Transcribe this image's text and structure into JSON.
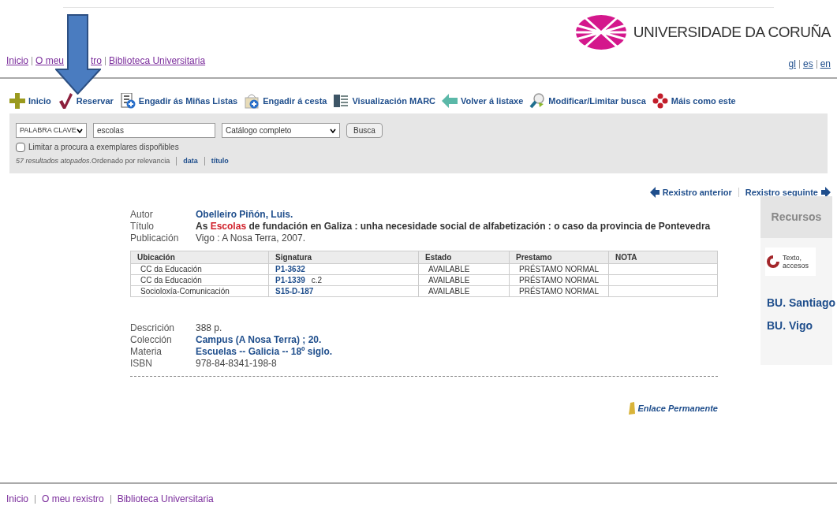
{
  "header": {
    "logo_text": "UNIVERSIDADE DA CORUÑA",
    "links": [
      {
        "parts": [
          "Inicio"
        ]
      },
      {
        "parts": [
          "O meu",
          "tro"
        ]
      },
      {
        "parts": [
          "Biblioteca Universitaria"
        ]
      }
    ],
    "languages": [
      "gl",
      "es",
      "en"
    ]
  },
  "toolbar": [
    {
      "kind": "plus",
      "label": "Inicio"
    },
    {
      "kind": "check",
      "label": "Reservar"
    },
    {
      "kind": "list",
      "label": "Engadir ás Miñas Listas"
    },
    {
      "kind": "bag",
      "label": "Engadir á cesta"
    },
    {
      "kind": "marc",
      "label": "Visualización MARC"
    },
    {
      "kind": "back",
      "label": "Volver á listaxe"
    },
    {
      "kind": "magnifier",
      "label": "Modificar/Limitar busca"
    },
    {
      "kind": "dots",
      "label": "Máis como este"
    }
  ],
  "search": {
    "index": "PALABRA CLAVE",
    "query": "escolas",
    "catalog": "Catálogo completo",
    "button": "Busca",
    "limit_label": "Limitar a procura a exemplares dispoñibles",
    "limit_checked": false,
    "results": "57 resultados atopados.",
    "sort_text": "Ordenado por relevancia",
    "sort_links": [
      "data",
      "título"
    ]
  },
  "record_nav": {
    "previous": "Rexistro anterior",
    "next": "Rexistro seguinte"
  },
  "record": {
    "fields": [
      {
        "label": "Autor",
        "kind": "link",
        "value": "Obelleiro Piñón, Luis."
      },
      {
        "label": "Título",
        "kind": "title",
        "before": "As ",
        "highlight": "Escolas",
        "after": " de fundación en Galiza : unha necesidade social de alfabetización : o caso da provincia de Pontevedra"
      },
      {
        "label": "Publicación",
        "kind": "plain",
        "value": "Vigo : A Nosa Terra, 2007."
      }
    ],
    "holdings": {
      "columns": [
        "Ubicación",
        "Signatura",
        "Estado",
        "Prestamo",
        "NOTA"
      ],
      "rows": [
        {
          "location": "CC da Educación",
          "signature": "P1-3632",
          "status": "AVAILABLE",
          "loan": "PRÉSTAMO NORMAL"
        },
        {
          "location": "CC da Educación",
          "signature": "P1-1339",
          "copy": "c.2",
          "status": "AVAILABLE",
          "loan": "PRÉSTAMO NORMAL"
        },
        {
          "location": "Socioloxía-Comunicación",
          "signature": "S15-D-187",
          "status": "AVAILABLE",
          "loan": "PRÉSTAMO NORMAL"
        }
      ]
    },
    "details": [
      {
        "label": "Descrición",
        "kind": "plain",
        "value": "388 p."
      },
      {
        "label": "Colección",
        "kind": "link",
        "value": "Campus (A Nosa Terra) ;  20."
      },
      {
        "label": "Materia",
        "kind": "link",
        "value": "Escuelas -- Galicia -- 18º siglo."
      },
      {
        "label": "ISBN",
        "kind": "plain",
        "value": "978-84-8341-198-8"
      }
    ],
    "permalink": "Enlace Permanente"
  },
  "resources": {
    "title": "Recursos",
    "text_access": [
      "Texto,",
      "accesos"
    ],
    "links": [
      "BU. Santiago",
      "BU. Vigo"
    ]
  },
  "footer": {
    "links": [
      "Inicio",
      "O meu rexistro",
      "Biblioteca Universitaria"
    ]
  }
}
